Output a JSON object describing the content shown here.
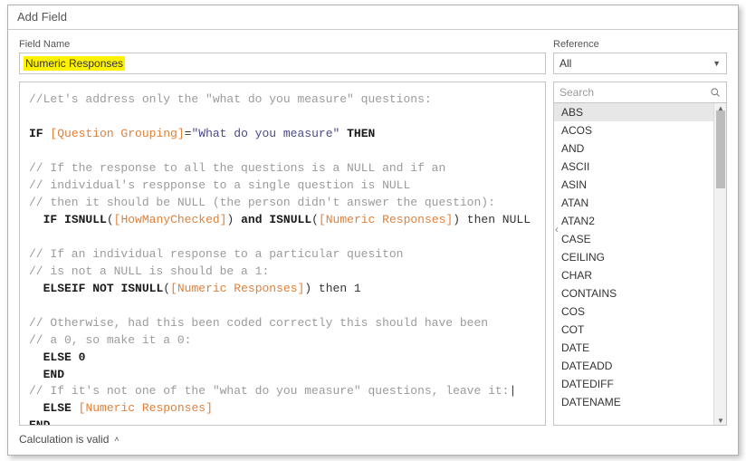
{
  "dialog_title": "Add Field",
  "field_name_label": "Field Name",
  "field_name_value": "Numeric Responses",
  "reference_label": "Reference",
  "reference_selected": "All",
  "search_placeholder": "Search",
  "functions": [
    "ABS",
    "ACOS",
    "AND",
    "ASCII",
    "ASIN",
    "ATAN",
    "ATAN2",
    "CASE",
    "CEILING",
    "CHAR",
    "CONTAINS",
    "COS",
    "COT",
    "DATE",
    "DATEADD",
    "DATEDIFF",
    "DATENAME"
  ],
  "functions_selected_index": 0,
  "footer_status": "Calculation is valid",
  "code": {
    "c1": "//Let's address only the \"what do you measure\" questions:",
    "kw_if": "IF",
    "fld_qg": "[Question Grouping]",
    "eq": "=",
    "str_wdym": "\"What do you measure\"",
    "kw_then": "THEN",
    "c2": "// If the response to all the questions is a NULL and if an",
    "c3": "// individual's respponse to a single question is NULL",
    "c4": "// then it should be NULL (the person didn't answer the question):",
    "ind": "  ",
    "fn_isnull": "ISNULL",
    "lp": "(",
    "rp": ")",
    "fld_hmc": "[HowManyChecked]",
    "kw_and_l": "and",
    "fld_nr": "[Numeric Responses]",
    "txt_then_null": " then NULL",
    "c5": "// If an individual response to a particular quesiton",
    "c6": "// is not a NULL is should be a 1:",
    "kw_elseif": "ELSEIF",
    "kw_not": "NOT",
    "txt_then_1": " then 1",
    "c7": "// Otherwise, had this been coded correctly this should have been",
    "c8": "// a 0, so make it a 0:",
    "kw_else_0": "ELSE 0",
    "kw_end": "END",
    "c9": "// If it's not one of the \"what do you measure\" questions, leave it:",
    "kw_else": "ELSE",
    "cursor": "|"
  }
}
